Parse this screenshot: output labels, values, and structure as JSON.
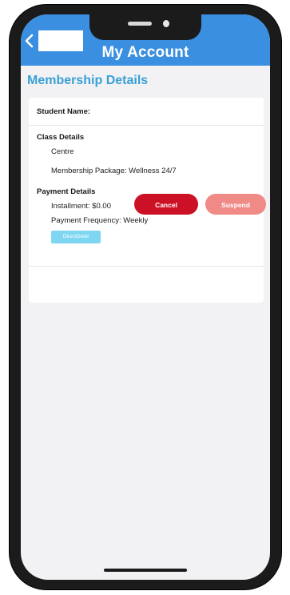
{
  "header": {
    "title": "My Account"
  },
  "page": {
    "section_title": "Membership Details"
  },
  "details": {
    "student_name_label": "Student Name:",
    "class_details_label": "Class Details",
    "centre_label": "Centre",
    "membership_package": "Membership Package: Wellness 24/7",
    "payment_details_label": "Payment Details",
    "installment": "Installment: $0.00",
    "payment_frequency": "Payment Frequency: Weekly",
    "payment_method": "DirectDebit"
  },
  "actions": {
    "cancel_label": "Cancel",
    "suspend_label": "Suspend"
  },
  "colors": {
    "app_bar": "#3a8fe0",
    "section_title": "#3aa0d4",
    "cancel_button": "#cc1126",
    "suspend_button": "#f08a86",
    "payment_chip": "#7fd6f2"
  }
}
